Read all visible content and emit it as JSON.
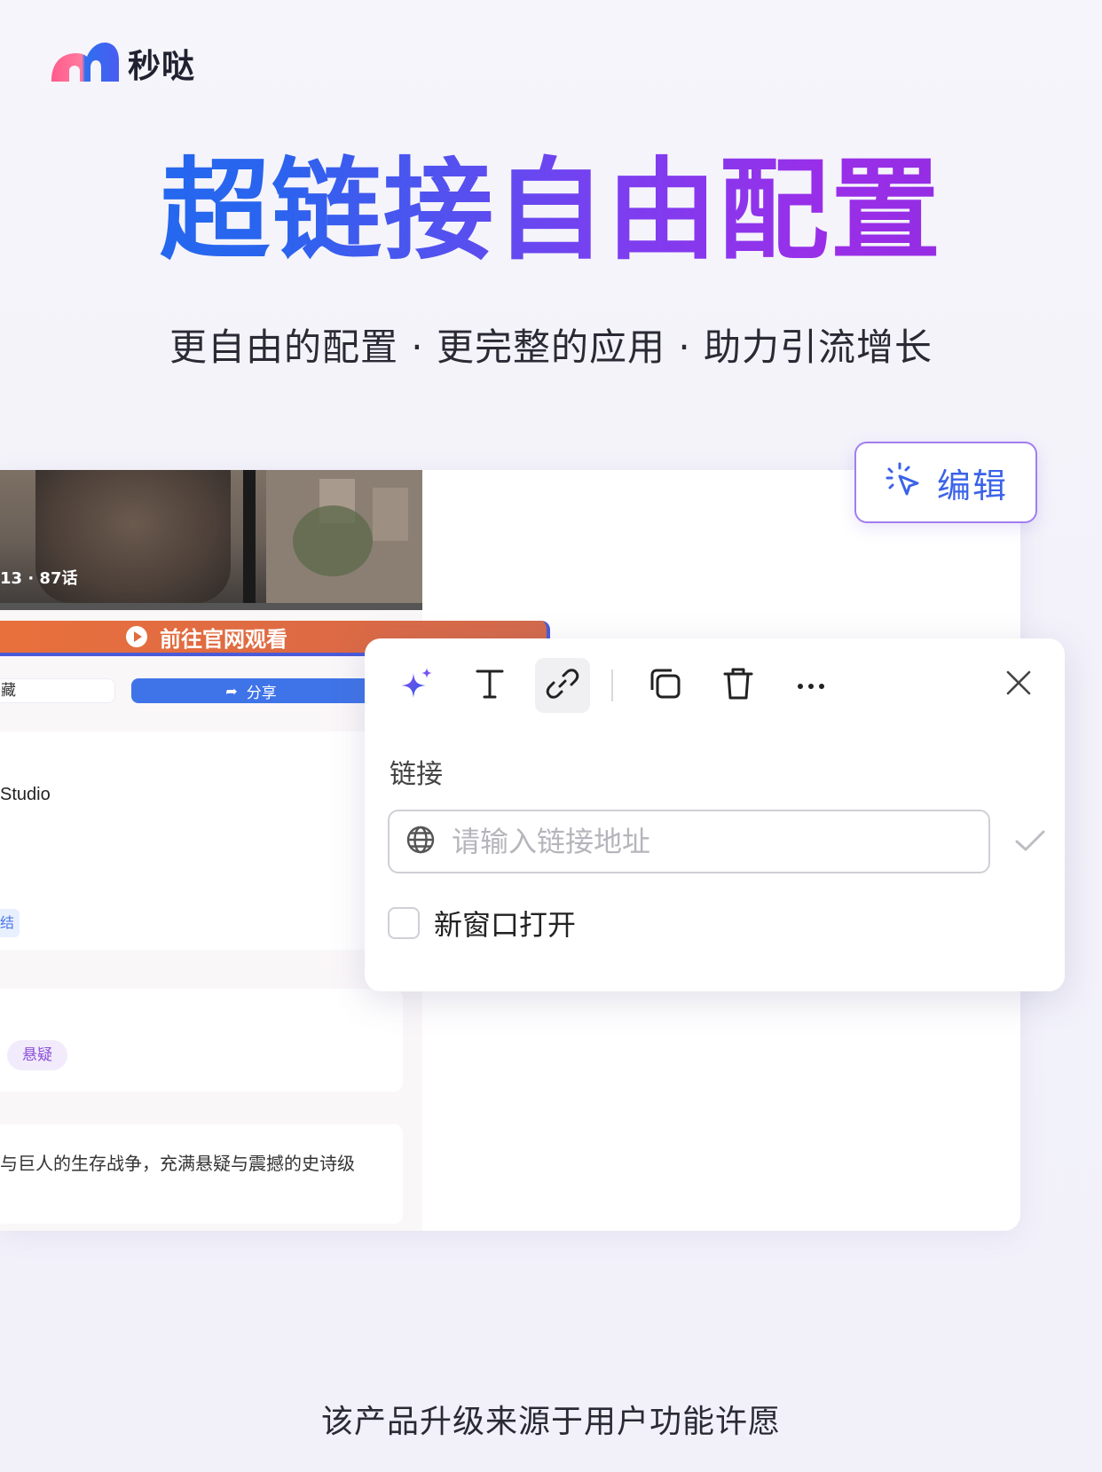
{
  "brand": {
    "name": "秒哒"
  },
  "headline": "超链接自由配置",
  "subtitle": "更自由的配置 · 更完整的应用 · 助力引流增长",
  "footer": "该产品升级来源于用户功能许愿",
  "screen": {
    "poster_caption": "13 · 87话",
    "watch_button": "前往官网观看",
    "fav_button": "藏",
    "share_button": "分享",
    "studio": "Studio",
    "status_tag": "结",
    "genre_tag": "悬疑",
    "description": "与巨人的生存战争，充满悬疑与震撼的史诗级"
  },
  "edit_tag": {
    "label": "编辑"
  },
  "popup": {
    "toolbar": [
      "ai-sparkle-icon",
      "text-icon",
      "link-icon",
      "copy-icon",
      "delete-icon",
      "more-icon"
    ],
    "active_tool": "link-icon",
    "field_label": "链接",
    "input_placeholder": "请输入链接地址",
    "input_value": "",
    "new_window_label": "新窗口打开",
    "new_window_checked": false
  },
  "colors": {
    "accent_blue": "#3b63e8",
    "accent_purple": "#9a2ee8",
    "watch_orange": "#e8703c"
  }
}
